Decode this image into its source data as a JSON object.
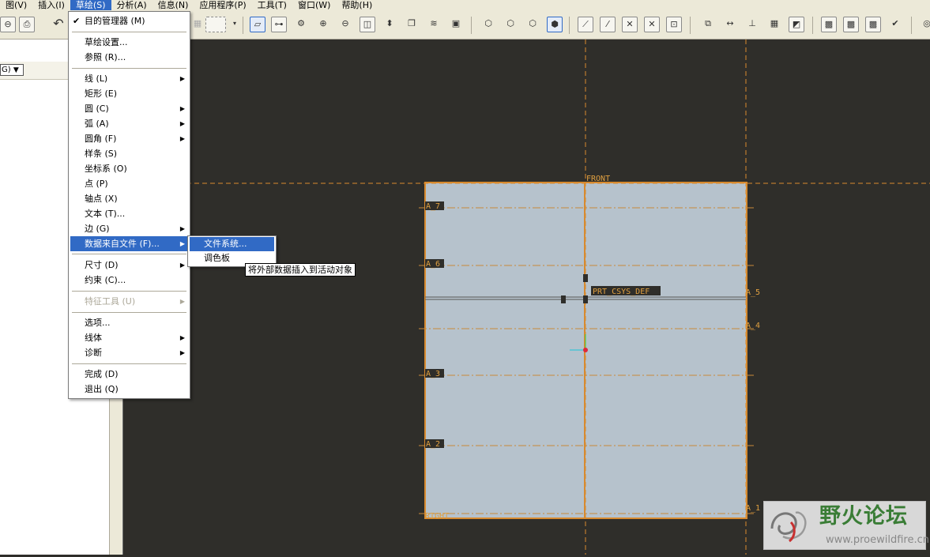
{
  "menubar": {
    "items": [
      "图(V)",
      "插入(I)",
      "草绘(S)",
      "分析(A)",
      "信息(N)",
      "应用程序(P)",
      "工具(T)",
      "窗口(W)",
      "帮助(H)"
    ],
    "active_index": 2
  },
  "left_panel": {
    "selector_value": "G)"
  },
  "sketch_menu": {
    "items": [
      {
        "label": "目的管理器 (M)",
        "checked": true
      },
      {
        "label": "草绘设置..."
      },
      {
        "label": "参照 (R)..."
      },
      {
        "label": "线 (L)",
        "submenu": true
      },
      {
        "label": "矩形 (E)"
      },
      {
        "label": "圆 (C)",
        "submenu": true
      },
      {
        "label": "弧 (A)",
        "submenu": true
      },
      {
        "label": "圆角 (F)",
        "submenu": true
      },
      {
        "label": "样条 (S)"
      },
      {
        "label": "坐标系 (O)"
      },
      {
        "label": "点 (P)"
      },
      {
        "label": "轴点 (X)"
      },
      {
        "label": "文本 (T)..."
      },
      {
        "label": "边 (G)",
        "submenu": true
      },
      {
        "label": "数据来自文件 (F)...",
        "submenu": true,
        "highlighted": true
      },
      {
        "label": "尺寸 (D)",
        "submenu": true
      },
      {
        "label": "约束 (C)..."
      },
      {
        "label": "特征工具 (U)",
        "submenu": true,
        "disabled": true
      },
      {
        "label": "选项..."
      },
      {
        "label": "线体",
        "submenu": true
      },
      {
        "label": "诊断",
        "submenu": true
      },
      {
        "label": "完成 (D)"
      },
      {
        "label": "退出 (Q)"
      }
    ]
  },
  "data_from_file_submenu": {
    "items": [
      {
        "label": "文件系统...",
        "highlighted": true
      },
      {
        "label": "调色板"
      }
    ]
  },
  "tooltip": "将外部数据插入到活动对象",
  "sketch": {
    "labels": {
      "front": "FRONT",
      "right": "RIGHT",
      "csys": "PRT_CSYS_DEF",
      "a1": "A_1",
      "a2": "A_2",
      "a3": "A_3",
      "a4": "A_4",
      "a5": "A_5",
      "a6": "A_6",
      "a7": "A_7"
    },
    "colors": {
      "plane_fill": "#b6c2cc",
      "datum": "#d88a2e",
      "background": "#2f2e2a"
    }
  },
  "watermark": {
    "title": "野火论坛",
    "url": "www.proewildfire.cn"
  }
}
